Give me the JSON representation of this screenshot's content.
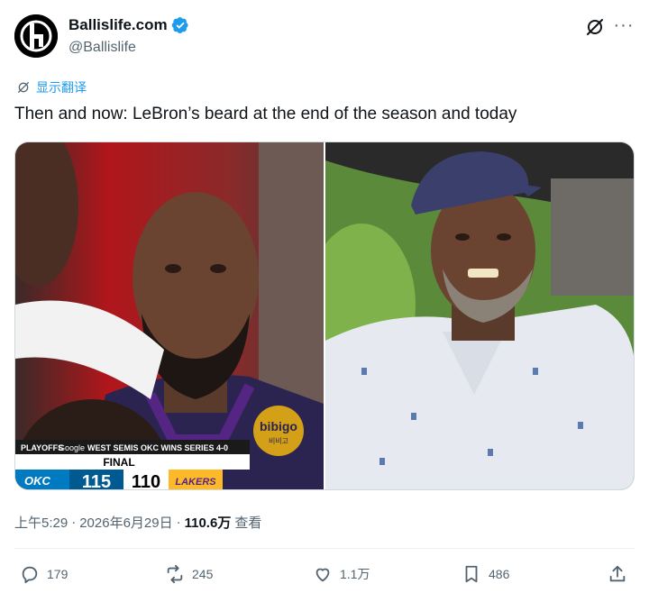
{
  "author": {
    "display_name": "Ballislife.com",
    "handle": "@Ballislife",
    "verified": true,
    "avatar_icon": "ballislife-logo"
  },
  "translate_label": "显示翻译",
  "text": "Then and now: LeBron’s beard at the end of the season and today",
  "media": {
    "left_photo": {
      "scoreboard": {
        "playoffs": "PLAYOFFS",
        "sponsor": "Google",
        "series": "WEST SEMIS OKC WINS SERIES 4-0",
        "status": "FINAL",
        "home_team": "OKC",
        "home_score": "115",
        "away_score": "110",
        "away_team": "LAKERS"
      },
      "jersey_patch": "bibigo",
      "jersey_patch_sub": "비비고"
    }
  },
  "meta": {
    "time": "上午5:29",
    "date": "2026年6月29日",
    "views_count": "110.6万",
    "views_label": "查看"
  },
  "actions": {
    "replies": "179",
    "reposts": "245",
    "likes": "1.1万",
    "bookmarks": "486"
  },
  "colors": {
    "accent": "#1d9bf0",
    "secondary_text": "#536471",
    "lakers_purple": "#552583",
    "okc_blue": "#007ac1"
  }
}
